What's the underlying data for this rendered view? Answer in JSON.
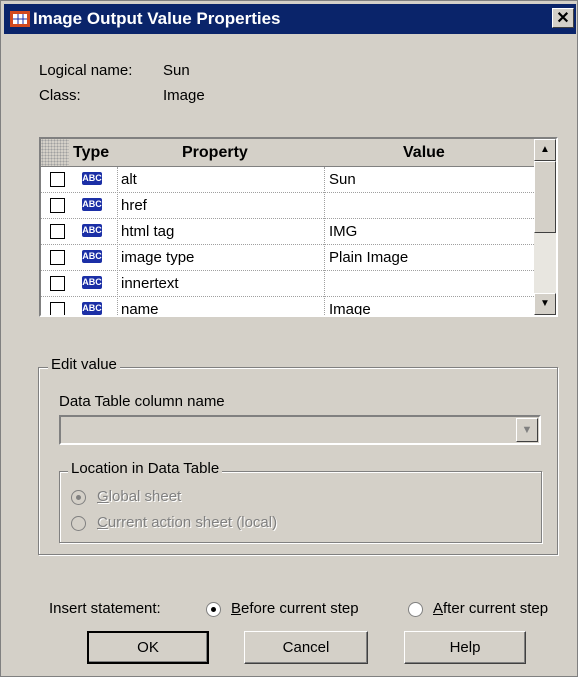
{
  "window": {
    "title": "Image Output Value Properties",
    "close_glyph": "✕"
  },
  "info": {
    "logical_name_label": "Logical name:",
    "logical_name_value": "Sun",
    "class_label": "Class:",
    "class_value": "Image"
  },
  "grid": {
    "headers": {
      "type": "Type",
      "property": "Property",
      "value": "Value"
    },
    "type_badge": "ABC",
    "rows": [
      {
        "checked": false,
        "property": "alt",
        "value": "Sun"
      },
      {
        "checked": false,
        "property": "href",
        "value": ""
      },
      {
        "checked": false,
        "property": "html tag",
        "value": "IMG"
      },
      {
        "checked": false,
        "property": "image type",
        "value": "Plain Image"
      },
      {
        "checked": false,
        "property": "innertext",
        "value": ""
      },
      {
        "checked": false,
        "property": "name",
        "value": "Image"
      }
    ]
  },
  "edit_value": {
    "title": "Edit value",
    "column_label": "Data Table column name",
    "column_value": "",
    "location": {
      "title": "Location in Data Table",
      "global_prefix": "G",
      "global_rest": "lobal sheet",
      "current_prefix": "C",
      "current_rest": "urrent action sheet (local)",
      "selected": "global"
    }
  },
  "insert": {
    "label": "Insert statement:",
    "before_prefix": "B",
    "before_rest": "efore current step",
    "after_prefix": "A",
    "after_rest": "fter current step",
    "selected": "before"
  },
  "buttons": {
    "ok": "OK",
    "cancel": "Cancel",
    "help": "Help"
  },
  "colors": {
    "title_bg": "#0a246a",
    "face": "#d4d0c8",
    "abc_badge": "#1b2fa6"
  }
}
